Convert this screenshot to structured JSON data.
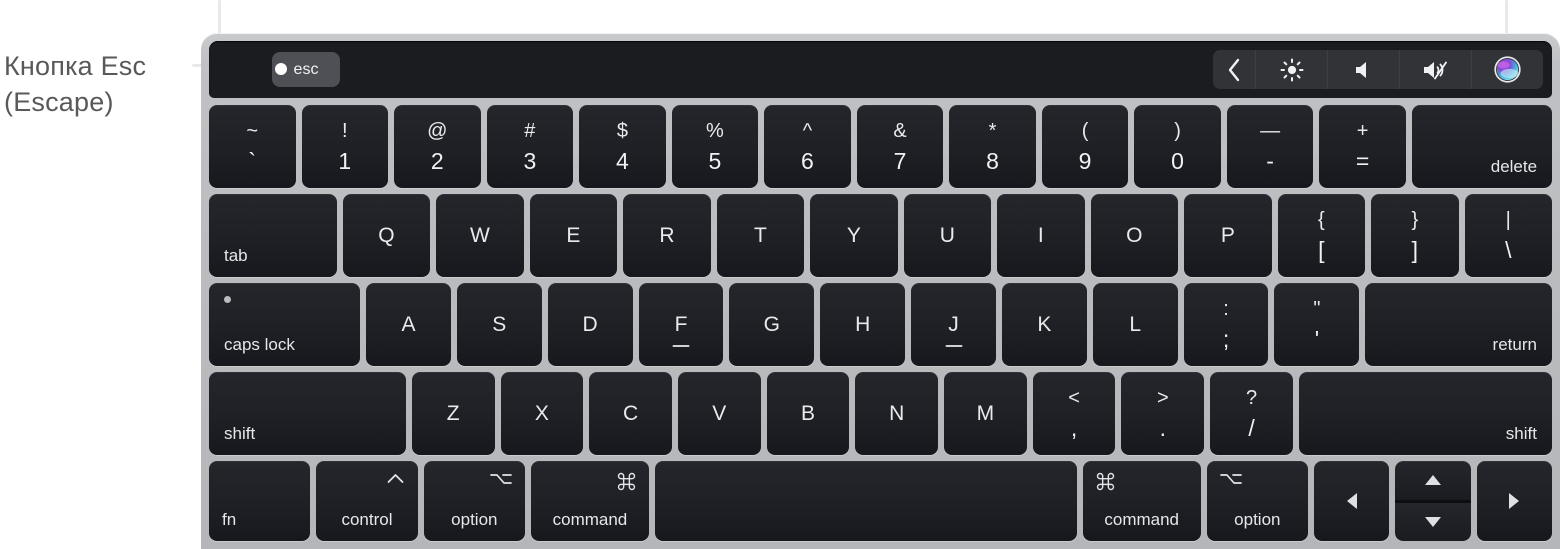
{
  "annotation": {
    "line1": "Кнопка Esc",
    "line2": "(Escape)",
    "color": "#58595b"
  },
  "touchbar": {
    "esc_label": "esc",
    "controls": [
      {
        "name": "chevron-left-icon",
        "label": "Back"
      },
      {
        "name": "brightness-icon",
        "label": "Brightness"
      },
      {
        "name": "volume-icon",
        "label": "Volume"
      },
      {
        "name": "mute-icon",
        "label": "Mute"
      },
      {
        "name": "siri-icon",
        "label": "Siri"
      }
    ]
  },
  "keyboard": {
    "rows": {
      "number": [
        {
          "type": "dual",
          "top": "~",
          "bot": "`",
          "name": "key-backtick"
        },
        {
          "type": "dual",
          "top": "!",
          "bot": "1",
          "name": "key-1"
        },
        {
          "type": "dual",
          "top": "@",
          "bot": "2",
          "name": "key-2"
        },
        {
          "type": "dual",
          "top": "#",
          "bot": "3",
          "name": "key-3"
        },
        {
          "type": "dual",
          "top": "$",
          "bot": "4",
          "name": "key-4"
        },
        {
          "type": "dual",
          "top": "%",
          "bot": "5",
          "name": "key-5"
        },
        {
          "type": "dual",
          "top": "^",
          "bot": "6",
          "name": "key-6"
        },
        {
          "type": "dual",
          "top": "&",
          "bot": "7",
          "name": "key-7"
        },
        {
          "type": "dual",
          "top": "*",
          "bot": "8",
          "name": "key-8"
        },
        {
          "type": "dual",
          "top": "(",
          "bot": "9",
          "name": "key-9"
        },
        {
          "type": "dual",
          "top": ")",
          "bot": "0",
          "name": "key-0"
        },
        {
          "type": "dual",
          "top": "—",
          "bot": "-",
          "name": "key-minus"
        },
        {
          "type": "dual",
          "top": "+",
          "bot": "=",
          "name": "key-equals"
        },
        {
          "type": "corner-right",
          "label": "delete",
          "name": "key-delete"
        }
      ],
      "tab": [
        {
          "type": "corner",
          "label": "tab",
          "name": "key-tab"
        },
        {
          "type": "letter",
          "label": "Q",
          "name": "key-q"
        },
        {
          "type": "letter",
          "label": "W",
          "name": "key-w"
        },
        {
          "type": "letter",
          "label": "E",
          "name": "key-e"
        },
        {
          "type": "letter",
          "label": "R",
          "name": "key-r"
        },
        {
          "type": "letter",
          "label": "T",
          "name": "key-t"
        },
        {
          "type": "letter",
          "label": "Y",
          "name": "key-y"
        },
        {
          "type": "letter",
          "label": "U",
          "name": "key-u"
        },
        {
          "type": "letter",
          "label": "I",
          "name": "key-i"
        },
        {
          "type": "letter",
          "label": "O",
          "name": "key-o"
        },
        {
          "type": "letter",
          "label": "P",
          "name": "key-p"
        },
        {
          "type": "dual",
          "top": "{",
          "bot": "[",
          "name": "key-bracket-left"
        },
        {
          "type": "dual",
          "top": "}",
          "bot": "]",
          "name": "key-bracket-right"
        },
        {
          "type": "dual",
          "top": "|",
          "bot": "\\",
          "name": "key-backslash"
        }
      ],
      "caps": [
        {
          "type": "capslock",
          "label": "caps lock",
          "name": "key-caps-lock"
        },
        {
          "type": "letter",
          "label": "A",
          "name": "key-a"
        },
        {
          "type": "letter",
          "label": "S",
          "name": "key-s"
        },
        {
          "type": "letter",
          "label": "D",
          "name": "key-d"
        },
        {
          "type": "letter-homing",
          "label": "F",
          "name": "key-f"
        },
        {
          "type": "letter",
          "label": "G",
          "name": "key-g"
        },
        {
          "type": "letter",
          "label": "H",
          "name": "key-h"
        },
        {
          "type": "letter-homing",
          "label": "J",
          "name": "key-j"
        },
        {
          "type": "letter",
          "label": "K",
          "name": "key-k"
        },
        {
          "type": "letter",
          "label": "L",
          "name": "key-l"
        },
        {
          "type": "dual",
          "top": ":",
          "bot": ";",
          "name": "key-semicolon"
        },
        {
          "type": "dual",
          "top": "\"",
          "bot": "'",
          "name": "key-quote"
        },
        {
          "type": "corner-right",
          "label": "return",
          "name": "key-return"
        }
      ],
      "shift": [
        {
          "type": "corner",
          "label": "shift",
          "name": "key-shift-left"
        },
        {
          "type": "letter",
          "label": "Z",
          "name": "key-z"
        },
        {
          "type": "letter",
          "label": "X",
          "name": "key-x"
        },
        {
          "type": "letter",
          "label": "C",
          "name": "key-c"
        },
        {
          "type": "letter",
          "label": "V",
          "name": "key-v"
        },
        {
          "type": "letter",
          "label": "B",
          "name": "key-b"
        },
        {
          "type": "letter",
          "label": "N",
          "name": "key-n"
        },
        {
          "type": "letter",
          "label": "M",
          "name": "key-m"
        },
        {
          "type": "dual",
          "top": "<",
          "bot": ",",
          "name": "key-comma"
        },
        {
          "type": "dual",
          "top": ">",
          "bot": ".",
          "name": "key-period"
        },
        {
          "type": "dual",
          "top": "?",
          "bot": "/",
          "name": "key-slash"
        },
        {
          "type": "corner-right",
          "label": "shift",
          "name": "key-shift-right"
        }
      ],
      "bottom": [
        {
          "type": "fn",
          "label": "fn",
          "sym": "",
          "name": "key-fn"
        },
        {
          "type": "mod",
          "label": "control",
          "sym": "control-icon",
          "name": "key-control"
        },
        {
          "type": "mod",
          "label": "option",
          "sym": "option-icon",
          "name": "key-option-left"
        },
        {
          "type": "mod",
          "label": "command",
          "sym": "command-icon",
          "name": "key-command-left"
        },
        {
          "type": "space",
          "label": "",
          "name": "key-space"
        },
        {
          "type": "mod-left",
          "label": "command",
          "sym": "command-icon",
          "name": "key-command-right"
        },
        {
          "type": "mod-left",
          "label": "option",
          "sym": "option-icon",
          "name": "key-option-right"
        },
        {
          "type": "arrow",
          "label": "left-arrow-icon",
          "name": "key-arrow-left"
        },
        {
          "type": "arrow-updown",
          "label": "up-down-arrow-icon",
          "name": "key-arrow-updown"
        },
        {
          "type": "arrow",
          "label": "right-arrow-icon",
          "name": "key-arrow-right"
        }
      ]
    }
  },
  "colors": {
    "chassis": "#b9bbbe",
    "key": "#1e2026",
    "key_text": "#e9eaec",
    "touchbar_bg": "#1b1c20",
    "esc_key": "#4e5055",
    "callout_line": "#e9e9ea"
  }
}
